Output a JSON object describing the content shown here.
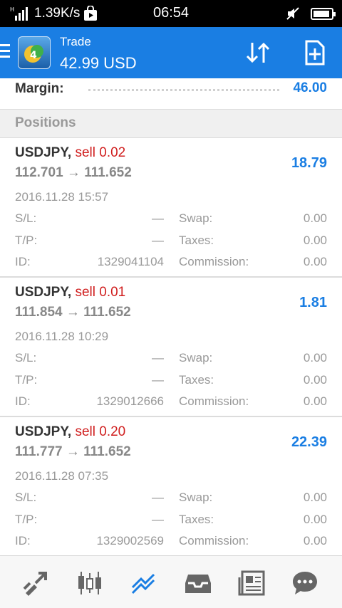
{
  "status_bar": {
    "network": "1.39K/s",
    "time": "06:54"
  },
  "app_bar": {
    "title": "Trade",
    "subtitle": "42.99 USD"
  },
  "margin": {
    "label": "Margin:",
    "value": "46.00"
  },
  "positions_header": "Positions",
  "labels": {
    "sl": "S/L:",
    "tp": "T/P:",
    "id": "ID:",
    "swap": "Swap:",
    "taxes": "Taxes:",
    "commission": "Commission:"
  },
  "positions": [
    {
      "symbol": "USDJPY,",
      "side": "sell 0.02",
      "prices": "112.701 → 111.652",
      "profit": "18.79",
      "time": "2016.11.28 15:57",
      "sl": "—",
      "tp": "—",
      "id": "1329041104",
      "swap": "0.00",
      "taxes": "0.00",
      "commission": "0.00"
    },
    {
      "symbol": "USDJPY,",
      "side": "sell 0.01",
      "prices": "111.854 → 111.652",
      "profit": "1.81",
      "time": "2016.11.28 10:29",
      "sl": "—",
      "tp": "—",
      "id": "1329012666",
      "swap": "0.00",
      "taxes": "0.00",
      "commission": "0.00"
    },
    {
      "symbol": "USDJPY,",
      "side": "sell 0.20",
      "prices": "111.777 → 111.652",
      "profit": "22.39",
      "time": "2016.11.28 07:35",
      "sl": "—",
      "tp": "—",
      "id": "1329002569",
      "swap": "0.00",
      "taxes": "0.00",
      "commission": "0.00"
    }
  ],
  "bottom_nav": [
    "quotes-icon",
    "chart-icon",
    "trade-icon",
    "history-icon",
    "news-icon",
    "chat-icon"
  ],
  "colors": {
    "accent": "#1a7ee3",
    "sell": "#d01f1f"
  }
}
